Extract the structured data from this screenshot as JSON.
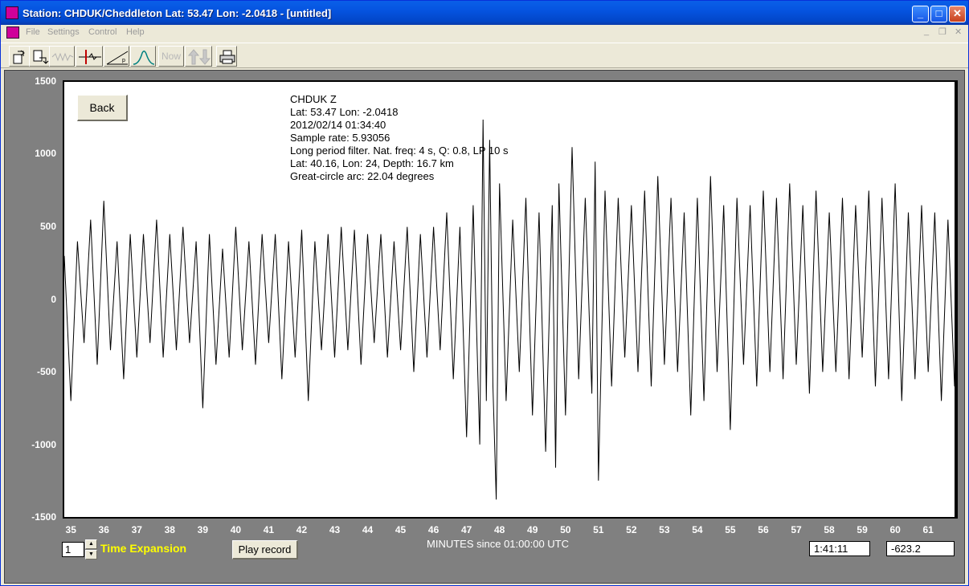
{
  "window": {
    "title": "Station: CHDUK/Cheddleton Lat: 53.47 Lon: -2.0418 - [untitled]",
    "minimize_label": "_",
    "maximize_label": "□",
    "close_label": "✕"
  },
  "menu": {
    "items": [
      "File",
      "Settings",
      "Control",
      "Help"
    ],
    "mdi_minimize": "_",
    "mdi_restore": "❐",
    "mdi_close": "✕"
  },
  "toolbar": {
    "now_label": "Now",
    "icons": [
      "open-icon",
      "save-icon",
      "waveform-icon",
      "cursor-marker-icon",
      "p-pick-icon",
      "spectrum-icon",
      "now-button",
      "up-down-icon",
      "print-icon"
    ]
  },
  "back_label": "Back",
  "info": {
    "station_channel": "CHDUK  Z",
    "station_location": "Lat: 53.47 Lon: -2.0418",
    "datetime": "2012/02/14 01:34:40",
    "sample_rate": "Sample rate: 5.93056",
    "filter": "Long period filter. Nat. freq: 4 s, Q: 0.8, LP 10 s",
    "event": "Lat: 40.16, Lon: 24, Depth: 16.7 km",
    "arc": "Great-circle arc: 22.04 degrees"
  },
  "chart_data": {
    "type": "line",
    "xlabel": "MINUTES since 01:00:00 UTC",
    "ylabel": "",
    "xlim": [
      34.8,
      61.8
    ],
    "ylim": [
      -1500,
      1500
    ],
    "y_ticks": [
      "1500",
      "1000",
      "500",
      "0",
      "-500",
      "-1000",
      "-1500"
    ],
    "x_ticks": [
      "35",
      "36",
      "37",
      "38",
      "39",
      "40",
      "41",
      "42",
      "43",
      "44",
      "45",
      "46",
      "47",
      "48",
      "49",
      "50",
      "51",
      "52",
      "53",
      "54",
      "55",
      "56",
      "57",
      "58",
      "59",
      "60",
      "61"
    ],
    "series": [
      {
        "x": [
          34.8,
          35.0,
          35.2,
          35.4,
          35.6,
          35.8,
          36.0,
          36.2,
          36.4,
          36.6,
          36.8,
          37.0,
          37.2,
          37.4,
          37.6,
          37.8,
          38.0,
          38.2,
          38.4,
          38.6,
          38.8,
          39.0,
          39.2,
          39.4,
          39.6,
          39.8,
          40.0,
          40.2,
          40.4,
          40.6,
          40.8,
          41.0,
          41.2,
          41.4,
          41.6,
          41.8,
          42.0,
          42.2,
          42.4,
          42.6,
          42.8,
          43.0,
          43.2,
          43.4,
          43.6,
          43.8,
          44.0,
          44.2,
          44.4,
          44.6,
          44.8,
          45.0,
          45.2,
          45.4,
          45.6,
          45.8,
          46.0,
          46.2,
          46.4,
          46.6,
          46.8,
          47.0,
          47.2,
          47.4,
          47.5,
          47.6,
          47.7,
          47.8,
          47.9,
          48.0,
          48.2,
          48.4,
          48.6,
          48.8,
          49.0,
          49.2,
          49.4,
          49.6,
          49.7,
          49.8,
          50.0,
          50.2,
          50.4,
          50.6,
          50.8,
          50.9,
          51.0,
          51.2,
          51.4,
          51.6,
          51.8,
          52.0,
          52.2,
          52.4,
          52.6,
          52.8,
          53.0,
          53.2,
          53.4,
          53.6,
          53.8,
          54.0,
          54.2,
          54.4,
          54.6,
          54.8,
          55.0,
          55.2,
          55.4,
          55.6,
          55.8,
          56.0,
          56.2,
          56.4,
          56.6,
          56.8,
          57.0,
          57.2,
          57.4,
          57.6,
          57.8,
          58.0,
          58.2,
          58.4,
          58.6,
          58.8,
          59.0,
          59.2,
          59.4,
          59.6,
          59.8,
          60.0,
          60.2,
          60.4,
          60.6,
          60.8,
          61.0,
          61.2,
          61.4,
          61.6,
          61.8
        ],
        "y": [
          300,
          -700,
          400,
          -300,
          550,
          -450,
          680,
          -350,
          400,
          -550,
          450,
          -400,
          450,
          -300,
          550,
          -400,
          450,
          -350,
          500,
          -300,
          400,
          -750,
          450,
          -450,
          350,
          -400,
          500,
          -350,
          400,
          -450,
          450,
          -300,
          450,
          -550,
          400,
          -400,
          480,
          -700,
          400,
          -350,
          450,
          -400,
          500,
          -350,
          480,
          -450,
          450,
          -300,
          450,
          -400,
          400,
          -350,
          500,
          -500,
          450,
          -400,
          500,
          -350,
          600,
          -550,
          500,
          -950,
          650,
          -1000,
          1240,
          -700,
          1100,
          -600,
          -1380,
          800,
          -700,
          550,
          -500,
          700,
          -800,
          600,
          -1050,
          650,
          -1160,
          800,
          -800,
          1050,
          -550,
          700,
          -650,
          950,
          -1250,
          750,
          -600,
          700,
          -400,
          650,
          -500,
          750,
          -600,
          850,
          -450,
          700,
          -500,
          600,
          -800,
          700,
          -700,
          850,
          -500,
          650,
          -900,
          700,
          -450,
          650,
          -600,
          750,
          -500,
          700,
          -550,
          800,
          -450,
          650,
          -650,
          750,
          -500,
          600,
          -500,
          700,
          -550,
          650,
          -400,
          750,
          -600,
          700,
          -550,
          800,
          -700,
          600,
          -550,
          650,
          -500,
          600,
          -700,
          550,
          -600
        ]
      }
    ]
  }
}
